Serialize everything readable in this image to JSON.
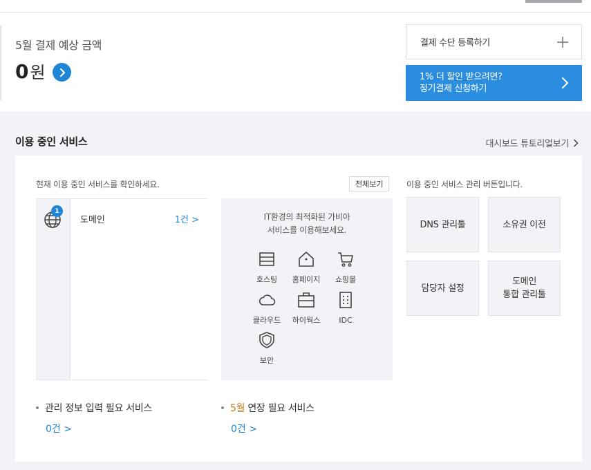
{
  "summary": {
    "title": "5월 결제 예상 금액",
    "amount": "0",
    "unit": "원"
  },
  "actions": {
    "register_payment": "결제 수단 등록하기",
    "promo_line1": "1% 더 할인 받으려면?",
    "promo_line2": "정기결제 신청하기"
  },
  "section": {
    "title": "이용 중인 서비스",
    "tutorial": "대시보드 튜토리얼보기"
  },
  "panel": {
    "caption_left": "현재 이용 중인 서비스를 확인하세요.",
    "view_all": "전체보기",
    "caption_right": "이용 중인 서비스 관리 버튼입니다.",
    "service": {
      "badge": "1",
      "name": "도메인",
      "count": "1건 >"
    },
    "promo_desc_line1": "IT환경의 최적화된 가비아",
    "promo_desc_line2": "서비스를 이용해보세요.",
    "icons": [
      {
        "label": "호스팅",
        "icon": "hosting-icon"
      },
      {
        "label": "홈페이지",
        "icon": "homepage-icon"
      },
      {
        "label": "쇼핑몰",
        "icon": "shopping-cart-icon"
      },
      {
        "label": "클라우드",
        "icon": "cloud-icon"
      },
      {
        "label": "하이웍스",
        "icon": "briefcase-icon"
      },
      {
        "label": "IDC",
        "icon": "server-icon"
      },
      {
        "label": "보안",
        "icon": "shield-icon"
      }
    ],
    "mgmt": {
      "dns": "DNS 관리툴",
      "ownership": "소유권 이전",
      "contact": "담당자 설정",
      "domain_line1": "도메인",
      "domain_line2": "통합 관리툴"
    },
    "info_needed": {
      "label": "관리 정보 입력 필요 서비스",
      "count": "0건 >"
    },
    "renewal": {
      "month": "5월",
      "label": " 연장 필요 서비스",
      "count": "0건 >"
    }
  },
  "colors": {
    "accent": "#1f86d6",
    "promo_bg": "#2b8de0",
    "month": "#c77d1f"
  }
}
